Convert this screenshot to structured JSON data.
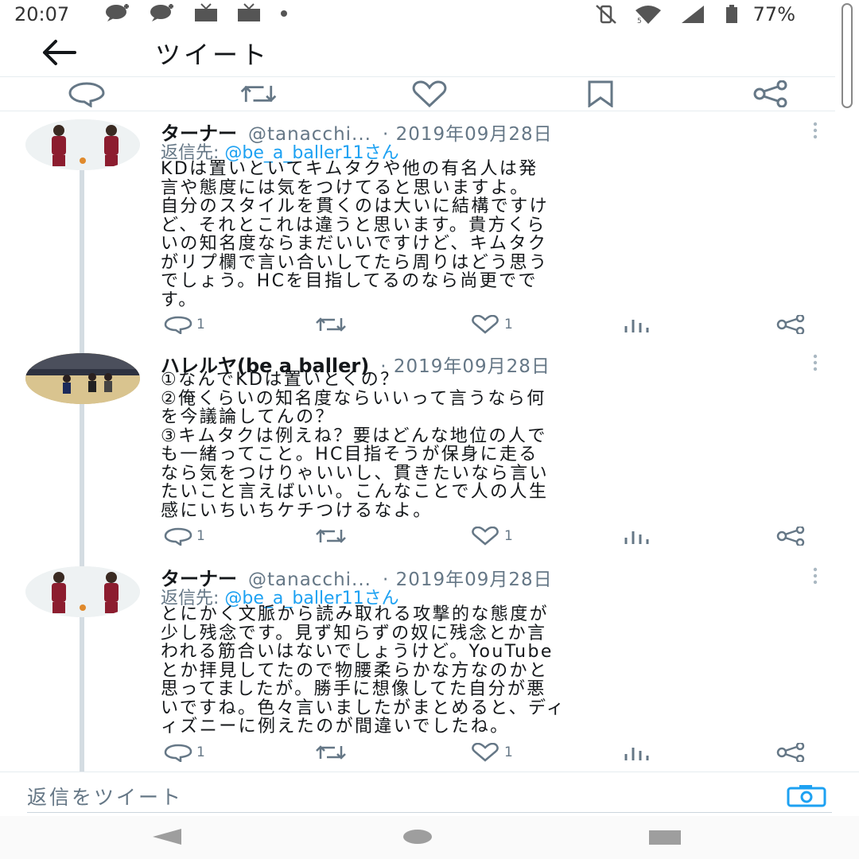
{
  "status_bar": {
    "time": "20:07",
    "notification_icons": [
      "chat-plus-icon",
      "chat-plus-icon",
      "tv-icon",
      "tv-icon",
      "dot-icon"
    ],
    "battery": "77%"
  },
  "header": {
    "title": "ツイート"
  },
  "colors": {
    "accent": "#1da1f2",
    "muted": "#657786",
    "text": "#14171a",
    "divider": "#e6ecf0"
  },
  "tweets": [
    {
      "name": "ターナー",
      "handle": "@tanacchi...",
      "date": "· 2019年09月28日",
      "reply_to_label": "返信先: ",
      "reply_to_user": "@be_a_baller11さん",
      "text": "KDは置いといてキムタクや他の有名人は発\n言や態度には気をつけてると思いますよ。\n自分のスタイルを貫くのは大いに結構ですけ\nど、それとこれは違うと思います。貴方くら\nいの知名度ならまだいいですけど、キムタク\nがリプ欄で言い合いしてたら周りはどう思う\nでしょう。HCを目指してるのなら尚更でで\nす。",
      "reply_count": "1",
      "like_count": "1"
    },
    {
      "name": "ハレルヤ(be a baller)",
      "handle": "",
      "date": "· 2019年09月28日",
      "text": "①なんでKDは置いとくの？\n②俺くらいの知名度ならいいって言うなら何\nを今議論してんの？\n③キムタクは例えね？要はどんな地位の人で\nも一緒ってこと。HC目指そうが保身に走る\nなら気をつけりゃいいし、貫きたいなら言い\nたいこと言えばいい。こんなことで人の人生\n感にいちいちケチつけるなよ。",
      "reply_count": "1",
      "like_count": "1"
    },
    {
      "name": "ターナー",
      "handle": "@tanacchi...",
      "date": "· 2019年09月28日",
      "reply_to_label": "返信先: ",
      "reply_to_user": "@be_a_baller11さん",
      "text": "とにかく文脈から読み取れる攻撃的な態度が\n少し残念です。見ず知らずの奴に残念とか言\nわれる筋合いはないでしょうけど。YouTube\nとか拝見してたので物腰柔らかな方なのかと\n思ってましたが。勝手に想像してた自分が悪\nいですね。色々言いましたがまとめると、ディ\nィズニーに例えたのが間違いでしたね。",
      "reply_count": "1",
      "like_count": "1"
    }
  ],
  "reply_bar": {
    "placeholder": "返信をツイート"
  }
}
